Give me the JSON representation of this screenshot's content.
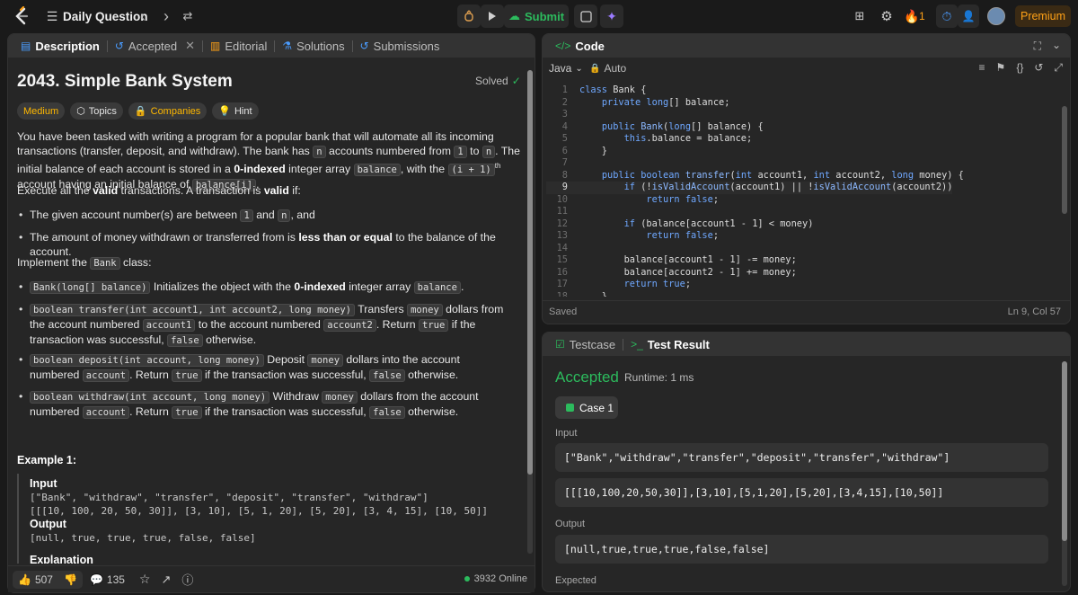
{
  "topbar": {
    "title": "Daily Question",
    "submit_label": "Submit",
    "streak": "1",
    "premium_label": "Premium"
  },
  "left_tabs": [
    "Description",
    "Accepted",
    "Editorial",
    "Solutions",
    "Submissions"
  ],
  "problem": {
    "title": "2043. Simple Bank System",
    "status": "Solved",
    "difficulty": "Medium",
    "tags": [
      "Topics",
      "Companies",
      "Hint"
    ],
    "p1_parts": [
      "You have been tasked with writing a program for a popular bank that will automate all its incoming transactions (transfer, deposit, and withdraw). The bank has ",
      "n",
      " accounts numbered from ",
      "1",
      " to ",
      "n",
      ". The initial balance of each account is stored in a ",
      "0-indexed",
      " integer array ",
      "balance",
      ", with the ",
      "(i + 1)",
      "th",
      " account having an initial balance of ",
      "balance[i]",
      "."
    ],
    "p2_parts": [
      "Execute all the ",
      "valid",
      " transactions. A transaction is ",
      "valid",
      " if:"
    ],
    "valid_rules": [
      [
        "The given account number(s) are between ",
        "1",
        " and ",
        "n",
        ", and"
      ],
      [
        "The amount of money withdrawn or transferred from is ",
        "less than or equal",
        " to the balance of the account."
      ]
    ],
    "p3_parts": [
      "Implement the ",
      "Bank",
      " class:"
    ],
    "methods": [
      [
        "Bank(long[] balance)",
        " Initializes the object with the ",
        "0-indexed",
        " integer array ",
        "balance",
        "."
      ],
      [
        "boolean transfer(int account1, int account2, long money)",
        " Transfers ",
        "money",
        " dollars from the account numbered ",
        "account1",
        " to the account numbered ",
        "account2",
        ". Return ",
        "true",
        " if the transaction was successful, ",
        "false",
        " otherwise."
      ],
      [
        "boolean deposit(int account, long money)",
        " Deposit ",
        "money",
        " dollars into the account numbered ",
        "account",
        ". Return ",
        "true",
        " if the transaction was successful, ",
        "false",
        " otherwise."
      ],
      [
        "boolean withdraw(int account, long money)",
        " Withdraw ",
        "money",
        " dollars from the account numbered ",
        "account",
        ". Return ",
        "true",
        " if the transaction was successful, ",
        "false",
        " otherwise."
      ]
    ],
    "example_title": "Example 1:",
    "example": {
      "input_label": "Input",
      "input_line1": "[\"Bank\", \"withdraw\", \"transfer\", \"deposit\", \"transfer\", \"withdraw\"]",
      "input_line2": "[[[10, 100, 20, 50, 30]], [3, 10], [5, 1, 20], [5, 20], [3, 4, 15], [10, 50]]",
      "output_label": "Output",
      "output_line": "[null, true, true, true, false, false]",
      "explanation_label": "Explanation"
    }
  },
  "footer": {
    "likes": "507",
    "comments": "135",
    "online": "3932 Online"
  },
  "code_panel": {
    "title": "Code",
    "language": "Java",
    "mode": "Auto",
    "saved": "Saved",
    "cursor": "Ln 9, Col 57",
    "lines": [
      "class Bank {",
      "    private long[] balance;",
      "",
      "    public Bank(long[] balance) {",
      "        this.balance = balance;",
      "    }",
      "",
      "    public boolean transfer(int account1, int account2, long money) {",
      "        if (!isValidAccount(account1) || !isValidAccount(account2))",
      "            return false;",
      "",
      "        if (balance[account1 - 1] < money)",
      "            return false;",
      "",
      "        balance[account1 - 1] -= money;",
      "        balance[account2 - 1] += money;",
      "        return true;",
      "    }"
    ]
  },
  "result_panel": {
    "tab_testcase": "Testcase",
    "tab_result": "Test Result",
    "status": "Accepted",
    "runtime": "Runtime: 1 ms",
    "case_label": "Case 1",
    "input_label": "Input",
    "input_line1": "[\"Bank\",\"withdraw\",\"transfer\",\"deposit\",\"transfer\",\"withdraw\"]",
    "input_line2": "[[[10,100,20,50,30]],[3,10],[5,1,20],[5,20],[3,4,15],[10,50]]",
    "output_label": "Output",
    "output_line": "[null,true,true,true,false,false]",
    "expected_label": "Expected"
  },
  "colors": {
    "accent_green": "#2cbb5d",
    "medium": "#ffb800",
    "premium": "#ffa116"
  }
}
